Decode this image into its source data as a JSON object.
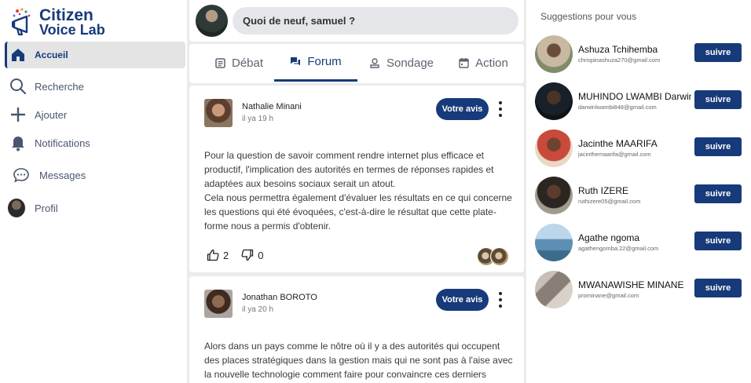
{
  "brand": {
    "line1": "Citizen",
    "line2": "Voice Lab"
  },
  "sidebar": {
    "items": [
      {
        "label": "Accueil",
        "icon": "home-icon",
        "active": true
      },
      {
        "label": "Recherche",
        "icon": "search-icon"
      },
      {
        "label": "Ajouter",
        "icon": "plus-icon"
      },
      {
        "label": "Notifications",
        "icon": "bell-icon"
      },
      {
        "label": "Messages",
        "icon": "chat-icon"
      },
      {
        "label": "Profil",
        "icon": "avatar"
      }
    ]
  },
  "composer": {
    "placeholder": "Quoi de neuf, samuel ?"
  },
  "tabs": [
    {
      "label": "Débat",
      "icon": "debate-icon"
    },
    {
      "label": "Forum",
      "icon": "forum-icon",
      "active": true
    },
    {
      "label": "Sondage",
      "icon": "poll-icon"
    },
    {
      "label": "Action",
      "icon": "calendar-icon"
    }
  ],
  "posts": [
    {
      "author": "Nathalie Minani",
      "time": "il ya 19 h",
      "button": "Votre avis",
      "text": "Pour la question de savoir comment rendre internet plus efficace et productif, l'implication des autorités en termes de réponses rapides et adaptées aux besoins sociaux serait un atout.\n Cela nous permettra également d'évaluer les résultats en ce qui concerne les questions qui été évoquées, c'est-à-dire le résultat que cette plate-forme nous a permis d'obtenir.",
      "likes": "2",
      "dislikes": "0"
    },
    {
      "author": "Jonathan BOROTO",
      "time": "il ya 20 h",
      "button": "Votre avis",
      "text": "Alors dans un pays comme le nôtre où il y a des autorités qui occupent des places stratégiques dans la gestion mais qui ne sont pas à l'aise avec la nouvelle technologie comment faire pour convaincre ces derniers"
    }
  ],
  "suggestions": {
    "title": "Suggestions pour vous",
    "follow_label": "suivre",
    "people": [
      {
        "name": "Ashuza Tchihemba",
        "email": "chrispinashuza270@gmail.com"
      },
      {
        "name": "MUHINDO LWAMBI Darwin",
        "email": "darwinlwambi848@gmail.com"
      },
      {
        "name": "Jacinthe MAARIFA",
        "email": "jacinthemaarifa@gmail.com"
      },
      {
        "name": "Ruth IZERE",
        "email": "ruthizere05@gmail.com"
      },
      {
        "name": "Agathe ngoma",
        "email": "agathengomba.22@gmail.com"
      },
      {
        "name": "MWANAWISHE MINANE",
        "email": "prominane@gmail.com"
      }
    ]
  },
  "colors": {
    "primary": "#173a7a",
    "background": "#ebebeb"
  }
}
